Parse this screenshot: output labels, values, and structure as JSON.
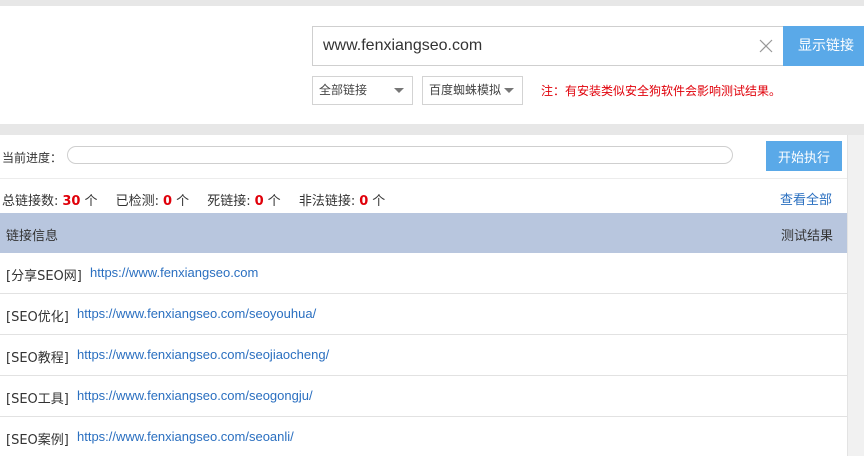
{
  "search": {
    "url_value": "www.fenxiangseo.com",
    "show_button": "显示链接"
  },
  "filters": {
    "link_type": "全部链接",
    "spider_mode": "百度蜘蛛模拟",
    "note": "注：有安装类似安全狗软件会影响测试结果。"
  },
  "progress": {
    "label": "当前进度：",
    "value": 0,
    "start_button": "开始执行"
  },
  "stats": {
    "total_label": "总链接数:",
    "total_value": "30",
    "checked_label": "已检测:",
    "checked_value": "0",
    "dead_label": "死链接:",
    "dead_value": "0",
    "illegal_label": "非法链接:",
    "illegal_value": "0",
    "unit": "个",
    "view_all": "查看全部"
  },
  "table": {
    "col_info": "链接信息",
    "col_result": "测试结果",
    "rows": [
      {
        "tag": "[分享SEO网]",
        "url": "https://www.fenxiangseo.com"
      },
      {
        "tag": "[SEO优化]",
        "url": "https://www.fenxiangseo.com/seoyouhua/"
      },
      {
        "tag": "[SEO教程]",
        "url": "https://www.fenxiangseo.com/seojiaocheng/"
      },
      {
        "tag": "[SEO工具]",
        "url": "https://www.fenxiangseo.com/seogongju/"
      },
      {
        "tag": "[SEO案例]",
        "url": "https://www.fenxiangseo.com/seoanli/"
      }
    ]
  },
  "colors": {
    "accent": "#5aa9e8",
    "warning": "#e0000a",
    "link": "#2a6fc0",
    "header_bg": "#b8c6de"
  }
}
